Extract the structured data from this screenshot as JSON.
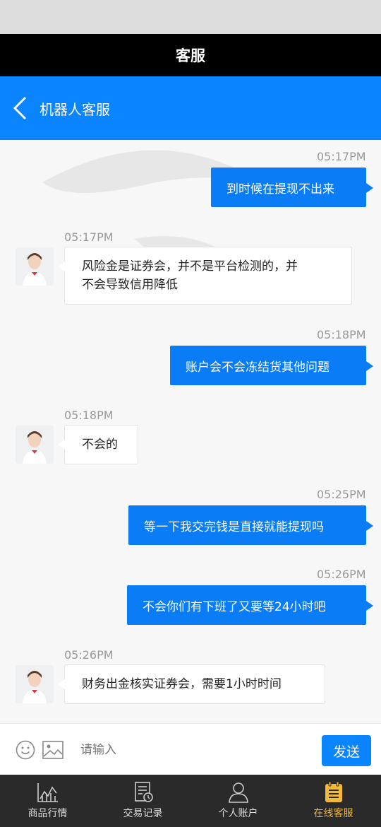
{
  "window": {
    "title": "客服"
  },
  "nav": {
    "title": "机器人客服"
  },
  "messages": [
    {
      "time": "05:17PM",
      "text": "到时候在提现不出来"
    },
    {
      "time": "05:17PM",
      "line1": "风险金是证券会，并不是平台检测的，并",
      "line2": "不会导致信用降低"
    },
    {
      "time": "05:18PM",
      "text": "账户会不会冻结货其他问题"
    },
    {
      "time": "05:18PM",
      "text": "不会的"
    },
    {
      "time": "05:25PM",
      "text": "等一下我交完钱是直接就能提现吗"
    },
    {
      "time": "05:26PM",
      "text": "不会你们有下班了又要等24小时吧"
    },
    {
      "time": "05:26PM",
      "text": "财务出金核实证券会，需要1小时时间"
    }
  ],
  "input": {
    "placeholder": "请输入",
    "send_label": "发送"
  },
  "tabs": [
    {
      "label": "商品行情",
      "icon": "chart-icon"
    },
    {
      "label": "交易记录",
      "icon": "record-icon"
    },
    {
      "label": "个人账户",
      "icon": "user-icon"
    },
    {
      "label": "在线客服",
      "icon": "service-icon"
    }
  ],
  "colors": {
    "accent": "#0a84ff",
    "active_tab": "#f0b93a",
    "tab_bar": "#2a2a2a"
  }
}
